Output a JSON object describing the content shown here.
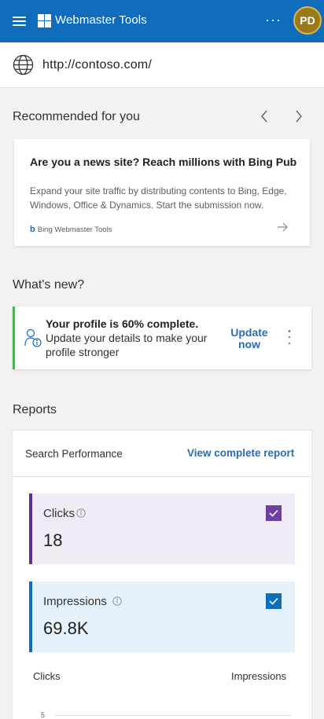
{
  "header": {
    "app_title": "Webmaster Tools",
    "more_label": "···",
    "avatar_initials": "PD",
    "brand_color": "#0f6cbd"
  },
  "site": {
    "url": "http://contoso.com/"
  },
  "recommended": {
    "title": "Recommended for you",
    "card": {
      "title": "Are you a news site? Reach millions with Bing Pub...",
      "body": "Expand your site traffic by distributing contents to Bing, Edge, Windows, Office & Dynamics. Start the submission now.",
      "source": "Bing Webmaster Tools"
    }
  },
  "whats_new": {
    "title": "What's new?",
    "card": {
      "title": "Your profile is 60% complete.",
      "body": "Update your details to make your profile stronger",
      "action": "Update now",
      "progress_percent": 60
    }
  },
  "reports": {
    "title": "Reports",
    "search_performance": "Search Performance",
    "view_report": "View complete report",
    "metrics": {
      "clicks": {
        "label": "Clicks",
        "value": "18",
        "checked": true,
        "color": "#5c2e91"
      },
      "impressions": {
        "label": "Impressions",
        "value": "69.8K",
        "checked": true,
        "color": "#0f6cbd"
      }
    },
    "chart": {
      "left_axis": "Clicks",
      "right_axis": "Impressions",
      "tick_top": "5"
    }
  },
  "icons": [
    "hamburger-icon",
    "windows-logo-icon",
    "more-icon",
    "globe-icon",
    "chevron-left-icon",
    "chevron-right-icon",
    "bing-logo-icon",
    "arrow-right-icon",
    "person-info-icon",
    "more-vertical-icon",
    "info-icon",
    "checkmark-icon"
  ]
}
